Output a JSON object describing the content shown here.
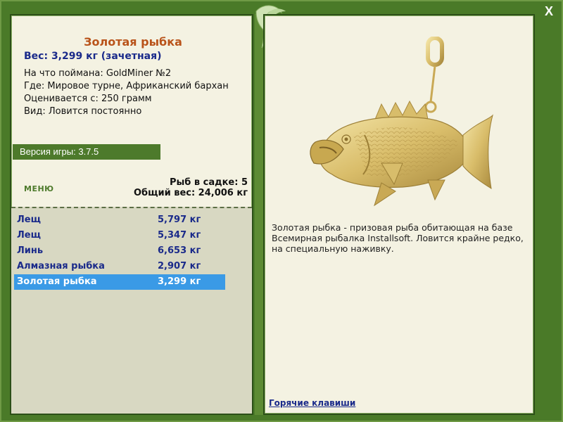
{
  "window": {
    "close_label": "X"
  },
  "fish_info": {
    "title": "Золотая рыбка",
    "weight": "Вес: 3,299 кг (зачетная)",
    "lines": [
      "На что поймана: GoldMiner №2",
      "Где: Мировое турне, Африканский бархан",
      "Оценивается с: 250 грамм",
      "Вид: Ловится постоянно"
    ]
  },
  "version": "Версия игры: 3.7.5",
  "menu_label": "МЕНЮ",
  "cage": {
    "count": "Рыб в садке: 5",
    "total": "Общий вес: 24,006 кг"
  },
  "fish_list": [
    {
      "name": "Лещ",
      "weight": "5,797 кг"
    },
    {
      "name": "Лещ",
      "weight": "5,347 кг"
    },
    {
      "name": "Линь",
      "weight": "6,653 кг"
    },
    {
      "name": "Алмазная рыбка",
      "weight": "2,907 кг"
    },
    {
      "name": "Золотая рыбка",
      "weight": "3,299 кг"
    }
  ],
  "selected_index": 4,
  "description": "Золотая рыбка - призовая рыба обитающая на базе Всемирная рыбалка Installsoft. Ловится крайне редко, на специальную наживку.",
  "hotkeys_label": "Горячие клавиши",
  "colors": {
    "frame": "#4a7a28",
    "panel_bg": "#f4f2e2",
    "list_bg": "#d8d8c2",
    "title": "#b9531a",
    "link": "#1a2a8a",
    "selection": "#3a9ae6"
  }
}
